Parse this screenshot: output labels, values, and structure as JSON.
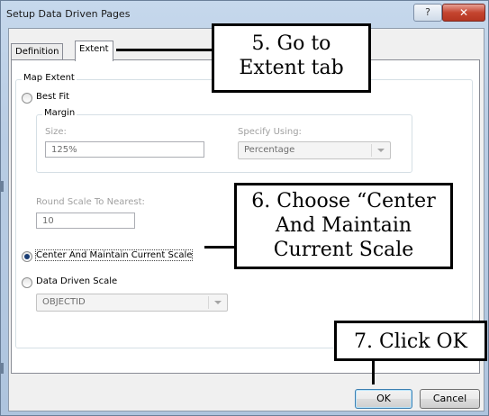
{
  "window": {
    "title": "Setup Data Driven Pages",
    "help_icon": "?",
    "close_icon": "✕"
  },
  "tabs": {
    "definition": "Definition",
    "extent": "Extent"
  },
  "map_extent": {
    "group_label": "Map Extent",
    "best_fit": {
      "label": "Best Fit",
      "margin_label": "Margin",
      "size_label": "Size:",
      "size_value": "125%",
      "specify_label": "Specify Using:",
      "specify_value": "Percentage"
    },
    "round_scale_label": "Round Scale To Nearest:",
    "round_scale_value": "10",
    "center_label": "Center And Maintain Current Scale",
    "data_driven_label": "Data Driven Scale",
    "data_driven_value": "OBJECTID"
  },
  "buttons": {
    "ok": "OK",
    "cancel": "Cancel"
  },
  "annotations": {
    "step5": "5. Go to Extent tab",
    "step6": "6. Choose “Center And Maintain Current Scale",
    "step7": "7. Click OK"
  },
  "selected_option": "center_and_maintain_current_scale"
}
